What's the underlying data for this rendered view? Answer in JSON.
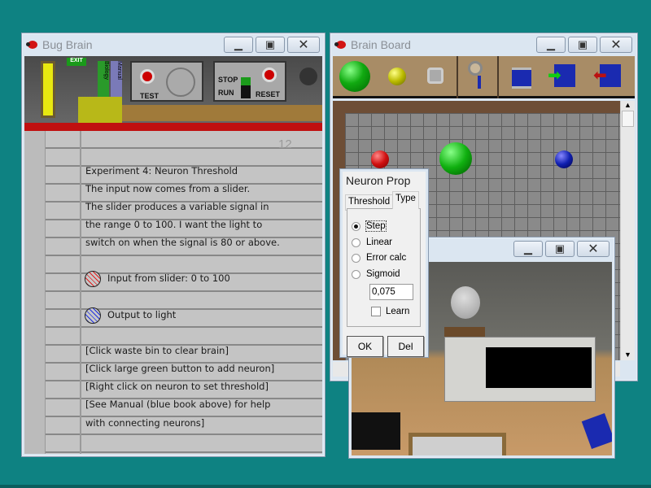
{
  "bug_brain": {
    "title": "Bug Brain",
    "shelf": {
      "exit_sign": "EXIT",
      "book_biology": "Biology",
      "book_manual": "Manual",
      "test_label": "TEST",
      "stop_label": "STOP",
      "run_label": "RUN",
      "reset_label": "RESET"
    },
    "page_number": "12",
    "lines": [
      "Experiment 4: Neuron Threshold",
      "The input now comes from a slider.",
      "The slider produces a variable signal in",
      "the range 0 to 100. I want the light to",
      "switch on when the signal is 80 or above."
    ],
    "input_text": "Input from slider: 0 to 100",
    "output_text": "Output to light",
    "instructions": [
      "[Click waste bin to clear brain]",
      "[Click large green button to add neuron]",
      "[Right click on neuron to set threshold]",
      "[See Manual (blue book above) for help",
      "with connecting neurons]"
    ]
  },
  "brain_board": {
    "title": "Brain Board",
    "tools": [
      "add-neuron",
      "add-small-neuron",
      "waste-bin",
      "magnifier",
      "spool",
      "save",
      "load"
    ]
  },
  "neuron_prop": {
    "title": "Neuron Prop",
    "tabs": [
      "Threshold",
      "Type"
    ],
    "active_tab": "Type",
    "types": [
      "Step",
      "Linear",
      "Error calc",
      "Sigmoid"
    ],
    "selected_type": "Step",
    "value": "0,075",
    "learn_label": "Learn",
    "learn_checked": false,
    "ok_label": "OK",
    "del_label": "Del"
  },
  "colors": {
    "desktop": "#0e8282",
    "neuron_input": "#d01010",
    "neuron_main": "#10b010",
    "neuron_output": "#1020b0"
  }
}
